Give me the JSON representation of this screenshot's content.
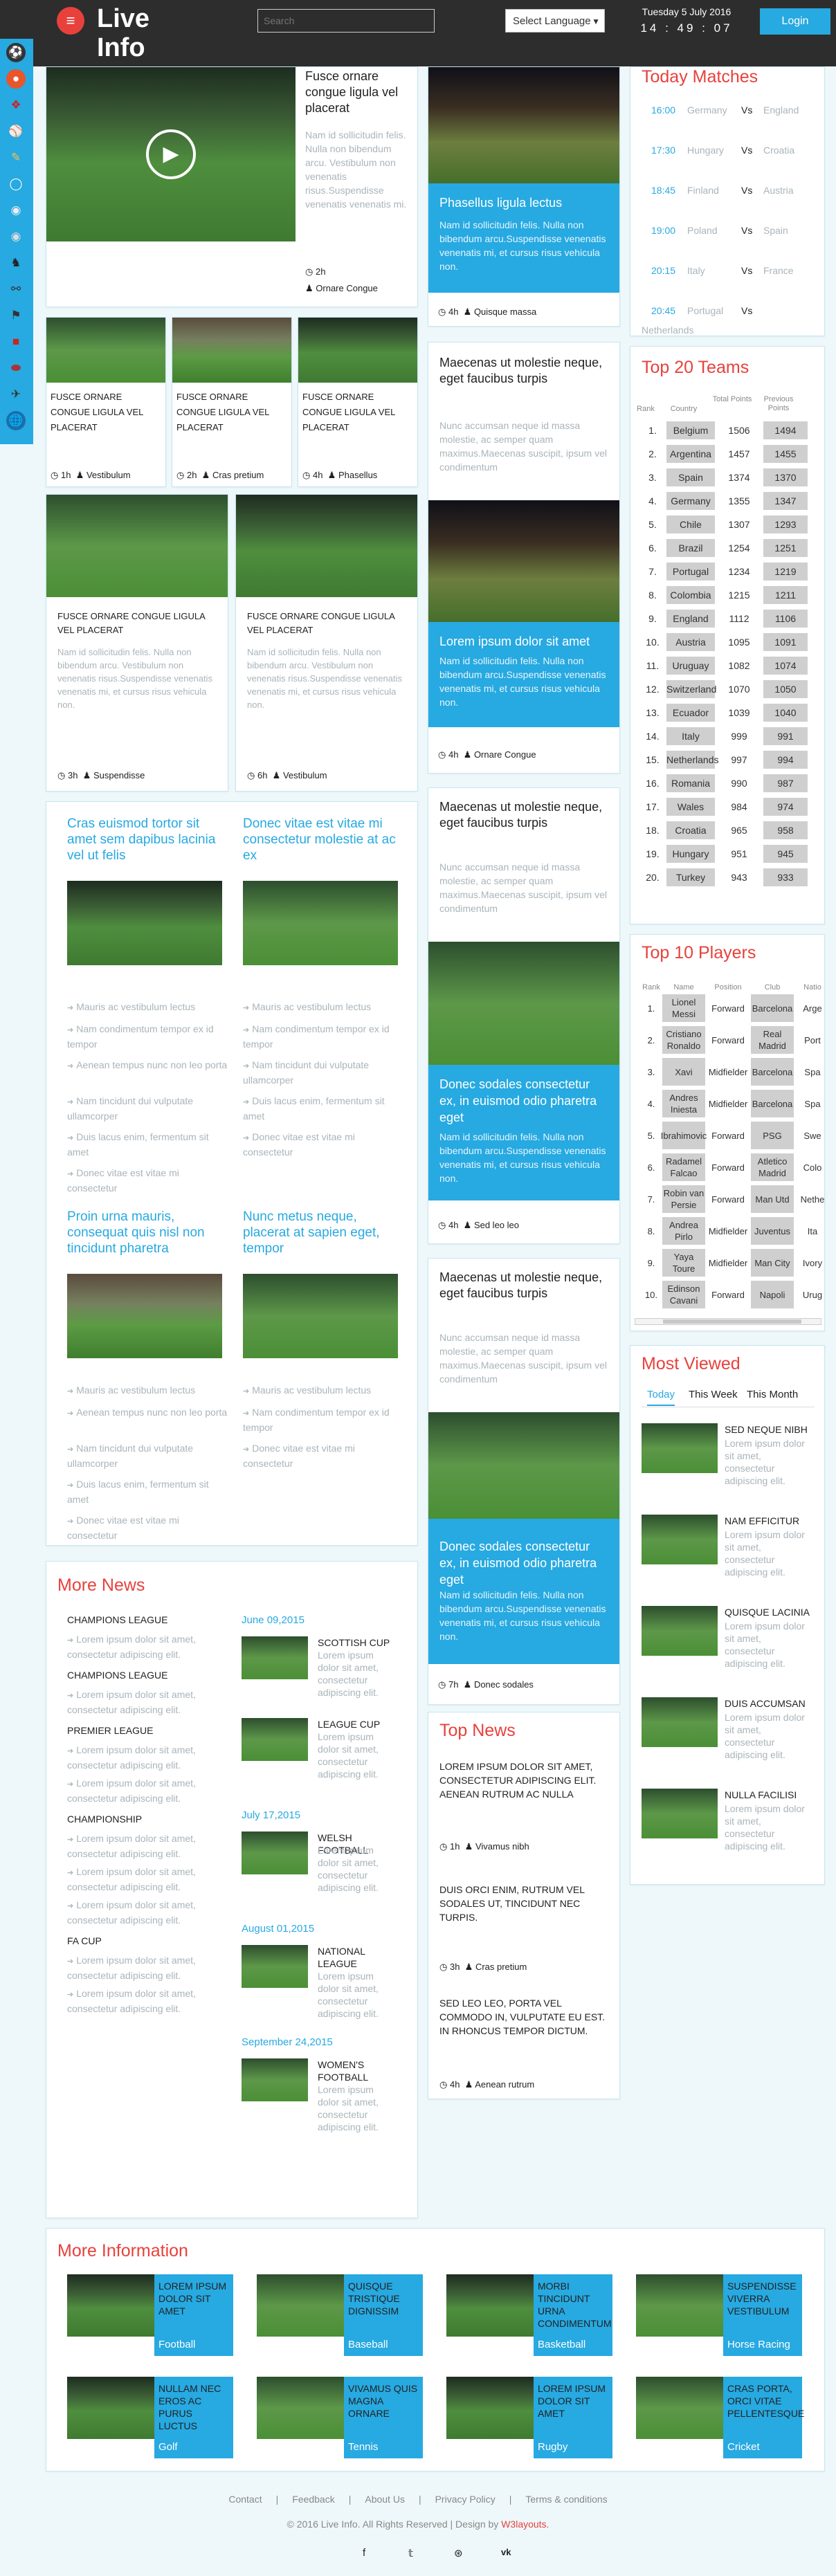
{
  "header": {
    "logo": "Live\nInfo",
    "menu_icon": "hamburger-icon",
    "search_placeholder": "Search",
    "language": "Select Language",
    "date": "Tuesday 5 July 2016",
    "time": "14 : 49 : 07",
    "login": "Login"
  },
  "sidebar": {
    "icons": [
      "soccer-icon",
      "basketball-icon",
      "hockey-icon",
      "baseball-icon",
      "cricket-icon",
      "golf-icon",
      "tennis-icon",
      "bowling-icon",
      "horse-racing-icon",
      "cycling-icon",
      "motorsport-icon",
      "boxing-icon",
      "rugby-icon",
      "formula-one-icon",
      "globe-icon"
    ]
  },
  "col1": {
    "feature": {
      "title": "Fusce ornare congue ligula vel placerat",
      "text": "Nam id sollicitudin felis. Nulla non bibendum arcu. Vestibulum non venenatis risus.Suspendisse venenatis venenatis mi.",
      "time": "2h",
      "author": "Ornare Congue"
    },
    "small": [
      {
        "title": "FUSCE ORNARE CONGUE LIGULA VEL PLACERAT",
        "time": "1h",
        "author": "Vestibulum"
      },
      {
        "title": "FUSCE ORNARE CONGUE LIGULA VEL PLACERAT",
        "time": "2h",
        "author": "Cras pretium"
      },
      {
        "title": "FUSCE ORNARE CONGUE LIGULA VEL PLACERAT",
        "time": "4h",
        "author": "Phasellus"
      }
    ],
    "medium": [
      {
        "title": "FUSCE ORNARE CONGUE LIGULA VEL PLACERAT",
        "text": "Nam id sollicitudin felis. Nulla non bibendum arcu. Vestibulum non venenatis risus.Suspendisse venenatis venenatis mi, et cursus risus vehicula non.",
        "time": "3h",
        "author": "Suspendisse"
      },
      {
        "title": "FUSCE ORNARE CONGUE LIGULA VEL PLACERAT",
        "text": "Nam id sollicitudin felis. Nulla non bibendum arcu. Vestibulum non venenatis risus.Suspendisse venenatis venenatis mi, et cursus risus vehicula non.",
        "time": "6h",
        "author": "Vestibulum"
      }
    ],
    "lists": [
      {
        "title": "Cras euismod tortor sit amet sem dapibus lacinia vel ut felis",
        "items": [
          "Mauris ac vestibulum lectus",
          "Nam condimentum tempor ex id tempor",
          "Aenean tempus nunc non leo porta",
          "Nam tincidunt dui vulputate ullamcorper",
          "Duis lacus enim, fermentum sit amet",
          "Donec vitae est vitae mi consectetur"
        ]
      },
      {
        "title": "Donec vitae est vitae mi consectetur molestie at ac ex",
        "items": [
          "Mauris ac vestibulum lectus",
          "Nam condimentum tempor ex id tempor",
          "Nam tincidunt dui vulputate ullamcorper",
          "Duis lacus enim, fermentum sit amet",
          "Donec vitae est vitae mi consectetur"
        ]
      },
      {
        "title": "Proin urna mauris, consequat quis nisl non tincidunt pharetra",
        "items": [
          "Mauris ac vestibulum lectus",
          "Aenean tempus nunc non leo porta",
          "Nam tincidunt dui vulputate ullamcorper",
          "Duis lacus enim, fermentum sit amet",
          "Donec vitae est vitae mi consectetur"
        ]
      },
      {
        "title": "Nunc metus neque, placerat at sapien eget, tempor",
        "items": [
          "Mauris ac vestibulum lectus",
          "Nam condimentum tempor ex id tempor",
          "Donec vitae est vitae mi consectetur"
        ]
      }
    ],
    "more_news": {
      "heading": "More News",
      "left": [
        {
          "head": "CHAMPIONS LEAGUE",
          "items": [
            "Lorem ipsum dolor sit amet, consectetur adipiscing elit."
          ]
        },
        {
          "head": "CHAMPIONS LEAGUE",
          "items": [
            "Lorem ipsum dolor sit amet, consectetur adipiscing elit."
          ]
        },
        {
          "head": "PREMIER LEAGUE",
          "items": [
            "Lorem ipsum dolor sit amet, consectetur adipiscing elit.",
            "Lorem ipsum dolor sit amet, consectetur adipiscing elit."
          ]
        },
        {
          "head": "CHAMPIONSHIP",
          "items": [
            "Lorem ipsum dolor sit amet, consectetur adipiscing elit.",
            "Lorem ipsum dolor sit amet, consectetur adipiscing elit.",
            "Lorem ipsum dolor sit amet, consectetur adipiscing elit."
          ]
        },
        {
          "head": "FA CUP",
          "items": [
            "Lorem ipsum dolor sit amet, consectetur adipiscing elit.",
            "Lorem ipsum dolor sit amet, consectetur adipiscing elit."
          ]
        }
      ],
      "right": [
        {
          "date": "June 09,2015",
          "entries": [
            {
              "title": "SCOTTISH CUP",
              "text": "Lorem ipsum dolor sit amet, consectetur adipiscing elit."
            },
            {
              "title": "LEAGUE CUP",
              "text": "Lorem ipsum dolor sit amet, consectetur adipiscing elit."
            }
          ]
        },
        {
          "date": "July 17,2015",
          "entries": [
            {
              "title": "WELSH FOOTBALL",
              "text": "Lorem ipsum dolor sit amet, consectetur adipiscing elit."
            }
          ]
        },
        {
          "date": "August 01,2015",
          "entries": [
            {
              "title": "NATIONAL LEAGUE",
              "text": "Lorem ipsum dolor sit amet, consectetur adipiscing elit."
            }
          ]
        },
        {
          "date": "September 24,2015",
          "entries": [
            {
              "title": "WOMEN'S FOOTBALL",
              "text": "Lorem ipsum dolor sit amet, consectetur adipiscing elit."
            }
          ]
        }
      ]
    }
  },
  "col2": {
    "blue1": {
      "title": "Phasellus ligula lectus",
      "text": "Nam id sollicitudin felis. Nulla non bibendum arcu.Suspendisse venenatis venenatis mi, et cursus risus vehicula non.",
      "time": "4h",
      "author": "Quisque massa"
    },
    "story1": {
      "title": "Maecenas ut molestie neque, eget faucibus turpis",
      "text": "Nunc accumsan neque id massa molestie, ac semper quam maximus.Maecenas suscipit, ipsum vel condimentum"
    },
    "blue2": {
      "title": "Lorem ipsum dolor sit amet",
      "text": "Nam id sollicitudin felis. Nulla non bibendum arcu.Suspendisse venenatis venenatis mi, et cursus risus vehicula non.",
      "time": "4h",
      "author": "Ornare Congue"
    },
    "story2": {
      "title": "Maecenas ut molestie neque, eget faucibus turpis",
      "text": "Nunc accumsan neque id massa molestie, ac semper quam maximus.Maecenas suscipit, ipsum vel condimentum"
    },
    "blue3": {
      "title": "Donec sodales consectetur ex, in euismod odio pharetra eget",
      "text": "Nam id sollicitudin felis. Nulla non bibendum arcu.Suspendisse venenatis venenatis mi, et cursus risus vehicula non.",
      "time": "4h",
      "author": "Sed leo leo"
    },
    "story3": {
      "title": "Maecenas ut molestie neque, eget faucibus turpis",
      "text": "Nunc accumsan neque id massa molestie, ac semper quam maximus.Maecenas suscipit, ipsum vel condimentum"
    },
    "blue4": {
      "title": "Donec sodales consectetur ex, in euismod odio pharetra eget",
      "text": "Nam id sollicitudin felis. Nulla non bibendum arcu.Suspendisse venenatis venenatis mi, et cursus risus vehicula non.",
      "time": "7h",
      "author": "Donec sodales"
    },
    "top_news": {
      "heading": "Top News",
      "items": [
        {
          "title": "LOREM IPSUM DOLOR SIT AMET, CONSECTETUR ADIPISCING ELIT. AENEAN RUTRUM AC NULLA",
          "time": "1h",
          "author": "Vivamus nibh"
        },
        {
          "title": "DUIS ORCI ENIM, RUTRUM VEL SODALES UT, TINCIDUNT NEC TURPIS.",
          "time": "3h",
          "author": "Cras pretium"
        },
        {
          "title": "SED LEO LEO, PORTA VEL COMMODO IN, VULPUTATE EU EST. IN RHONCUS TEMPOR DICTUM.",
          "time": "4h",
          "author": "Aenean rutrum"
        }
      ]
    }
  },
  "col3": {
    "today": {
      "heading": "Today Matches",
      "matches": [
        {
          "time": "16:00",
          "a": "Germany",
          "vs": "Vs",
          "b": "England"
        },
        {
          "time": "17:30",
          "a": "Hungary",
          "vs": "Vs",
          "b": "Croatia"
        },
        {
          "time": "18:45",
          "a": "Finland",
          "vs": "Vs",
          "b": "Austria"
        },
        {
          "time": "19:00",
          "a": "Poland",
          "vs": "Vs",
          "b": "Spain"
        },
        {
          "time": "20:15",
          "a": "Italy",
          "vs": "Vs",
          "b": "France"
        },
        {
          "time": "20:45",
          "a": "Portugal",
          "vs": "Vs",
          "b": "Netherlands"
        }
      ]
    },
    "teams": {
      "heading": "Top 20 Teams",
      "cols": [
        "Rank",
        "Country",
        "Total Points",
        "Previous Points"
      ],
      "rows": [
        [
          "1.",
          "Belgium",
          "1506",
          "1494"
        ],
        [
          "2.",
          "Argentina",
          "1457",
          "1455"
        ],
        [
          "3.",
          "Spain",
          "1374",
          "1370"
        ],
        [
          "4.",
          "Germany",
          "1355",
          "1347"
        ],
        [
          "5.",
          "Chile",
          "1307",
          "1293"
        ],
        [
          "6.",
          "Brazil",
          "1254",
          "1251"
        ],
        [
          "7.",
          "Portugal",
          "1234",
          "1219"
        ],
        [
          "8.",
          "Colombia",
          "1215",
          "1211"
        ],
        [
          "9.",
          "England",
          "1112",
          "1106"
        ],
        [
          "10.",
          "Austria",
          "1095",
          "1091"
        ],
        [
          "11.",
          "Uruguay",
          "1082",
          "1074"
        ],
        [
          "12.",
          "Switzerland",
          "1070",
          "1050"
        ],
        [
          "13.",
          "Ecuador",
          "1039",
          "1040"
        ],
        [
          "14.",
          "Italy",
          "999",
          "991"
        ],
        [
          "15.",
          "Netherlands",
          "997",
          "994"
        ],
        [
          "16.",
          "Romania",
          "990",
          "987"
        ],
        [
          "17.",
          "Wales",
          "984",
          "974"
        ],
        [
          "18.",
          "Croatia",
          "965",
          "958"
        ],
        [
          "19.",
          "Hungary",
          "951",
          "945"
        ],
        [
          "20.",
          "Turkey",
          "943",
          "933"
        ]
      ]
    },
    "players": {
      "heading": "Top 10 Players",
      "cols": [
        "Rank",
        "Name",
        "Position",
        "Club",
        "Natio"
      ],
      "rows": [
        [
          "1.",
          "Lionel Messi",
          "Forward",
          "Barcelona",
          "Arge"
        ],
        [
          "2.",
          "Cristiano Ronaldo",
          "Forward",
          "Real Madrid",
          "Port"
        ],
        [
          "3.",
          "Xavi",
          "Midfielder",
          "Barcelona",
          "Spa"
        ],
        [
          "4.",
          "Andres Iniesta",
          "Midfielder",
          "Barcelona",
          "Spa"
        ],
        [
          "5.",
          "Ibrahimovic",
          "Forward",
          "PSG",
          "Swe"
        ],
        [
          "6.",
          "Radamel Falcao",
          "Forward",
          "Atletico Madrid",
          "Colo"
        ],
        [
          "7.",
          "Robin van Persie",
          "Forward",
          "Man Utd",
          "Nethe"
        ],
        [
          "8.",
          "Andrea Pirlo",
          "Midfielder",
          "Juventus",
          "Ita"
        ],
        [
          "9.",
          "Yaya Toure",
          "Midfielder",
          "Man City",
          "Ivory"
        ],
        [
          "10.",
          "Edinson Cavani",
          "Forward",
          "Napoli",
          "Urug"
        ]
      ]
    },
    "most_viewed": {
      "heading": "Most Viewed",
      "tabs": [
        "Today",
        "This Week",
        "This Month"
      ],
      "items": [
        {
          "title": "SED NEQUE NIBH",
          "text": "Lorem ipsum dolor sit amet, consectetur adipiscing elit."
        },
        {
          "title": "NAM EFFICITUR",
          "text": "Lorem ipsum dolor sit amet, consectetur adipiscing elit."
        },
        {
          "title": "QUISQUE LACINIA",
          "text": "Lorem ipsum dolor sit amet, consectetur adipiscing elit."
        },
        {
          "title": "DUIS ACCUMSAN",
          "text": "Lorem ipsum dolor sit amet, consectetur adipiscing elit."
        },
        {
          "title": "NULLA FACILISI",
          "text": "Lorem ipsum dolor sit amet, consectetur adipiscing elit."
        }
      ]
    }
  },
  "more_info": {
    "heading": "More Information",
    "tiles": [
      {
        "title": "LOREM IPSUM DOLOR SIT AMET",
        "cat": "Football"
      },
      {
        "title": "QUISQUE TRISTIQUE DIGNISSIM",
        "cat": "Baseball"
      },
      {
        "title": "MORBI TINCIDUNT URNA CONDIMENTUM",
        "cat": "Basketball"
      },
      {
        "title": "SUSPENDISSE VIVERRA VESTIBULUM",
        "cat": "Horse Racing"
      },
      {
        "title": "NULLAM NEC EROS AC PURUS LUCTUS",
        "cat": "Golf"
      },
      {
        "title": "VIVAMUS QUIS MAGNA ORNARE",
        "cat": "Tennis"
      },
      {
        "title": "LOREM IPSUM DOLOR SIT AMET",
        "cat": "Rugby"
      },
      {
        "title": "CRAS PORTA, ORCI VITAE PELLENTESQUE",
        "cat": "Cricket"
      }
    ]
  },
  "footer": {
    "links": [
      "Contact",
      "|",
      "Feedback",
      "|",
      "About Us",
      "|",
      "Privacy Policy",
      "|",
      "Terms & conditions"
    ],
    "copy": "© 2016 Live Info. All Rights Reserved | Design by",
    "designer": "W3layouts.",
    "social": [
      "f",
      "t",
      "rss",
      "vk"
    ]
  },
  "colors": {
    "accent": "#27a9e1",
    "red": "#e8413c",
    "header": "#2d2d2d"
  }
}
